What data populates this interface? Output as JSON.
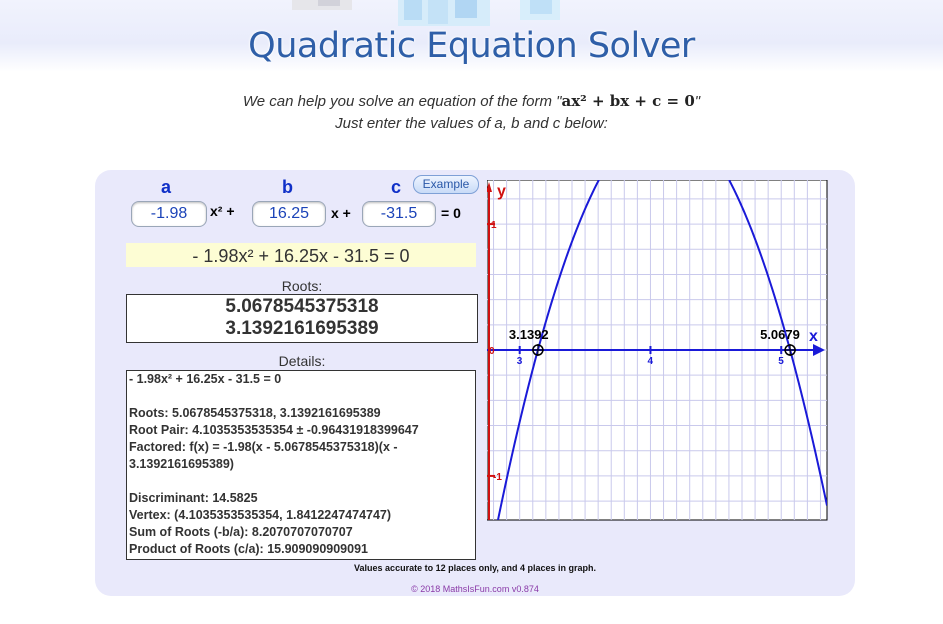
{
  "header": {
    "title": "Quadratic Equation Solver"
  },
  "intro": {
    "line1_prefix": "We can help you solve an equation of the form \"",
    "form_expression": "ax² + bx + c = 0",
    "line1_suffix": "\"",
    "line2": "Just enter the values of a, b and c below:"
  },
  "inputs": {
    "a_label": "a",
    "b_label": "b",
    "c_label": "c",
    "a_value": "-1.98",
    "b_value": "16.25",
    "c_value": "-31.5",
    "x2_term": "x² +",
    "x_term": "x +",
    "equals_zero": "= 0",
    "example_button": "Example"
  },
  "equation_display": "- 1.98x² + 16.25x - 31.5 = 0",
  "roots": {
    "caption": "Roots:",
    "root1": "5.0678545375318",
    "root2": "3.1392161695389"
  },
  "details": {
    "caption": "Details:",
    "equation": "- 1.98x² + 16.25x - 31.5 = 0",
    "roots_line": "Roots: 5.0678545375318, 3.1392161695389",
    "root_pair": "Root Pair: 4.1035353535354 ± -0.96431918399647",
    "factored": "Factored: f(x) = -1.98(x - 5.0678545375318)(x - 3.1392161695389)",
    "discriminant": "Discriminant: 14.5825",
    "vertex": "Vertex: (4.1035353535354, 1.8412247474747)",
    "sum_of_roots": "Sum of Roots (-b/a): 8.2070707070707",
    "product_of_roots": "Product of Roots (c/a): 15.909090909091"
  },
  "footer": {
    "accuracy_note": "Values accurate to 12 places only, and 4 places in graph.",
    "copyright": "© 2018 MathsIsFun.com v0.874"
  },
  "graph": {
    "y_axis_label": "y",
    "x_axis_label": "x",
    "y_tick_1": "1",
    "y_tick_0": "0",
    "y_tick_neg1": "-1",
    "x_tick_3": "3",
    "x_tick_4": "4",
    "x_tick_5": "5",
    "root_label_left": "3.1392",
    "root_label_right": "5.0679",
    "x_range": [
      2.75,
      5.35
    ],
    "y_range": [
      -1.35,
      1.35
    ],
    "coefficients": {
      "a": -1.98,
      "b": 16.25,
      "c": -31.5
    },
    "roots": [
      3.1392161695389,
      5.0678545375318
    ],
    "curve_color": "#1a1ad8",
    "axis_color": "#1a1ad8",
    "grid_color": "#c9c9ec"
  }
}
